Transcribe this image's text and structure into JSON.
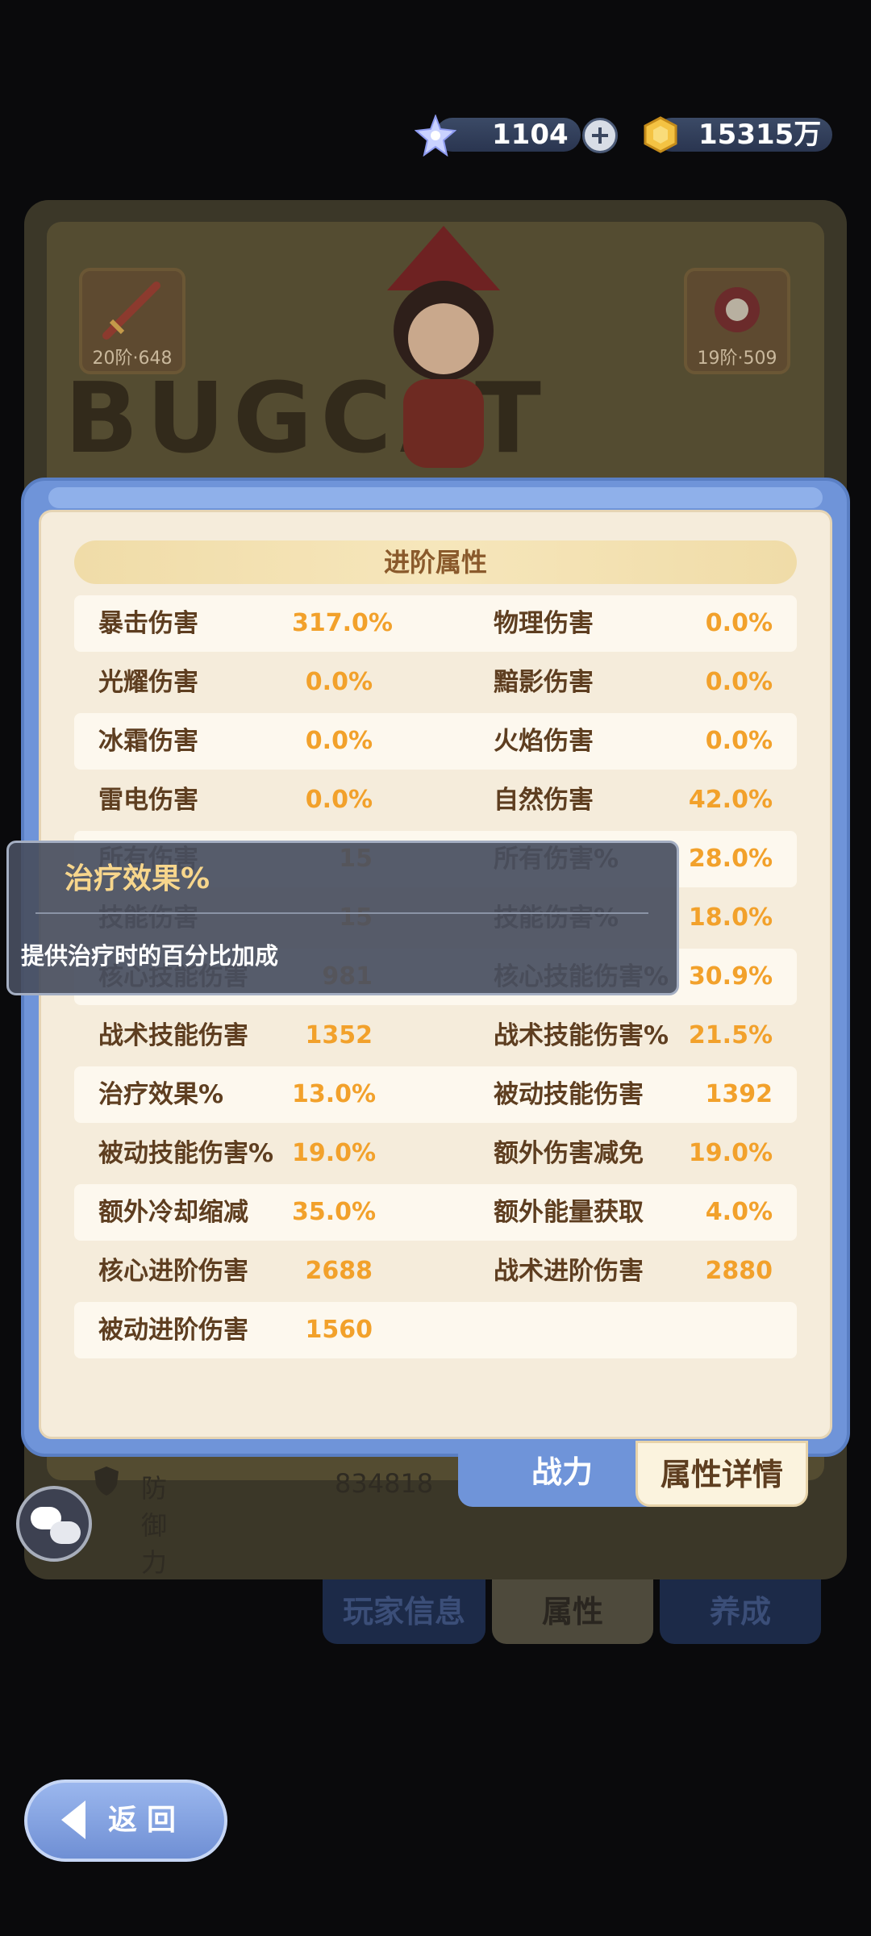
{
  "currency": {
    "gems": "1104",
    "gold": "15315万"
  },
  "background": {
    "banner_text": "BUGCAT CAPOO",
    "equip_left": "20阶·648",
    "equip_right": "19阶·509",
    "defense_label": "防御力",
    "defense_value": "834818",
    "tabs": [
      "玩家信息",
      "属性",
      "养成"
    ]
  },
  "modal": {
    "title": "进阶属性",
    "rows": [
      {
        "l_label": "暴击伤害",
        "l_value": "317.0%",
        "r_label": "物理伤害",
        "r_value": "0.0%"
      },
      {
        "l_label": "光耀伤害",
        "l_value": "0.0%",
        "r_label": "黯影伤害",
        "r_value": "0.0%"
      },
      {
        "l_label": "冰霜伤害",
        "l_value": "0.0%",
        "r_label": "火焰伤害",
        "r_value": "0.0%"
      },
      {
        "l_label": "雷电伤害",
        "l_value": "0.0%",
        "r_label": "自然伤害",
        "r_value": "42.0%"
      },
      {
        "l_label": "所有伤害",
        "l_value": "15",
        "r_label": "所有伤害%",
        "r_value": "28.0%"
      },
      {
        "l_label": "技能伤害",
        "l_value": "15",
        "r_label": "技能伤害%",
        "r_value": "18.0%"
      },
      {
        "l_label": "核心技能伤害",
        "l_value": "981",
        "r_label": "核心技能伤害%",
        "r_value": "30.9%"
      },
      {
        "l_label": "战术技能伤害",
        "l_value": "1352",
        "r_label": "战术技能伤害%",
        "r_value": "21.5%"
      },
      {
        "l_label": "治疗效果%",
        "l_value": "13.0%",
        "r_label": "被动技能伤害",
        "r_value": "1392"
      },
      {
        "l_label": "被动技能伤害%",
        "l_value": "19.0%",
        "r_label": "额外伤害减免",
        "r_value": "19.0%"
      },
      {
        "l_label": "额外冷却缩减",
        "l_value": "35.0%",
        "r_label": "额外能量获取",
        "r_value": "4.0%"
      },
      {
        "l_label": "核心进阶伤害",
        "l_value": "2688",
        "r_label": "战术进阶伤害",
        "r_value": "2880"
      },
      {
        "l_label": "被动进阶伤害",
        "l_value": "1560",
        "r_label": "",
        "r_value": ""
      }
    ],
    "tab_power": "战力",
    "tab_detail": "属性详情"
  },
  "tooltip": {
    "title": "治疗效果%",
    "description": "提供治疗时的百分比加成"
  },
  "back_label": "返回",
  "colors": {
    "accent_blue": "#6f94d9",
    "value_orange": "#f2a12b",
    "panel_cream": "#f5ecdb"
  },
  "icons": [
    "star-gem-icon",
    "gold-coin-icon",
    "plus-icon",
    "shield-icon",
    "chat-icon",
    "back-arrow-icon"
  ]
}
